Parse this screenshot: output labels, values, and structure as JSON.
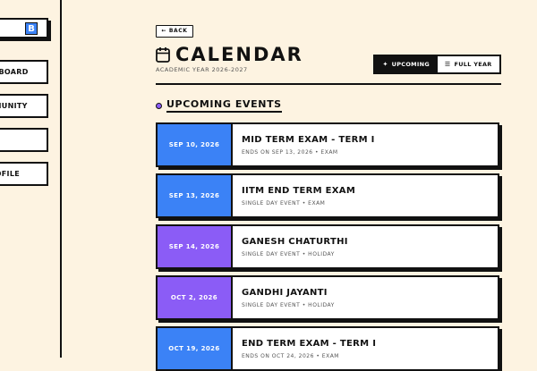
{
  "sidebar": {
    "logo_letter": "B",
    "items": [
      {
        "label": "DASHBOARD"
      },
      {
        "label": "COMMUNITY"
      },
      {
        "label": ""
      },
      {
        "label": "PROFILE"
      }
    ]
  },
  "header": {
    "back_label": "BACK",
    "title": "CALENDAR",
    "subtitle": "ACADEMIC YEAR 2026-2027",
    "toggle": {
      "upcoming_label": "UPCOMING",
      "full_year_label": "FULL YEAR",
      "active": "upcoming"
    }
  },
  "section": {
    "title": "UPCOMING EVENTS"
  },
  "colors": {
    "exam": "#3b82f6",
    "holiday": "#8b5cf6"
  },
  "events": [
    {
      "date": "SEP 10, 2026",
      "title": "MID TERM EXAM - TERM I",
      "meta": "ENDS ON SEP 13, 2026 • EXAM",
      "color": "#3b82f6"
    },
    {
      "date": "SEP 13, 2026",
      "title": "IITM END TERM EXAM",
      "meta": "SINGLE DAY EVENT • EXAM",
      "color": "#3b82f6"
    },
    {
      "date": "SEP 14, 2026",
      "title": "GANESH CHATURTHI",
      "meta": "SINGLE DAY EVENT • HOLIDAY",
      "color": "#8b5cf6"
    },
    {
      "date": "OCT 2, 2026",
      "title": "GANDHI JAYANTI",
      "meta": "SINGLE DAY EVENT • HOLIDAY",
      "color": "#8b5cf6"
    },
    {
      "date": "OCT 19, 2026",
      "title": "END TERM EXAM - TERM I",
      "meta": "ENDS ON OCT 24, 2026 • EXAM",
      "color": "#3b82f6"
    }
  ]
}
